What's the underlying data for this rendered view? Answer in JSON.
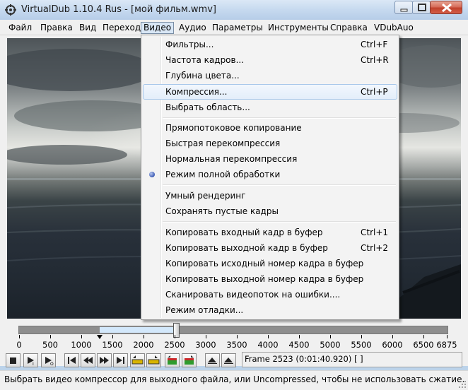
{
  "window": {
    "title": "VirtualDub 1.10.4 Rus - [мой фильм.wmv]"
  },
  "menubar": {
    "items": [
      "Файл",
      "Правка",
      "Вид",
      "Переход",
      "Видео",
      "Аудио",
      "Параметры",
      "Инструменты",
      "Справка",
      "VDubAuo"
    ],
    "open_item": "Видео"
  },
  "video_menu": {
    "items": [
      {
        "label": "Фильтры...",
        "shortcut": "Ctrl+F"
      },
      {
        "label": "Частота кадров...",
        "shortcut": "Ctrl+R"
      },
      {
        "label": "Глубина цвета...",
        "shortcut": ""
      },
      {
        "label": "Компрессия...",
        "shortcut": "Ctrl+P",
        "highlighted": true
      },
      {
        "label": "Выбрать область...",
        "shortcut": ""
      },
      {
        "label": "Прямопотоковое копирование",
        "shortcut": ""
      },
      {
        "label": "Быстрая перекомпрессия",
        "shortcut": ""
      },
      {
        "label": "Нормальная перекомпрессия",
        "shortcut": ""
      },
      {
        "label": "Режим полной обработки",
        "shortcut": "",
        "selected": true
      },
      {
        "label": "Умный рендеринг",
        "shortcut": ""
      },
      {
        "label": "Сохранять пустые кадры",
        "shortcut": ""
      },
      {
        "label": "Копировать входный кадр в буфер",
        "shortcut": "Ctrl+1"
      },
      {
        "label": "Копировать выходной кадр в буфер",
        "shortcut": "Ctrl+2"
      },
      {
        "label": "Копировать исходный номер кадра в буфер",
        "shortcut": ""
      },
      {
        "label": "Копировать выходной номер кадра в буфер",
        "shortcut": ""
      },
      {
        "label": "Сканировать видеопоток на ошибки....",
        "shortcut": ""
      },
      {
        "label": "Режим отладки...",
        "shortcut": ""
      }
    ]
  },
  "timeline": {
    "ticks": [
      "0",
      "500",
      "1000",
      "1500",
      "2000",
      "2500",
      "3000",
      "3500",
      "4000",
      "4500",
      "5000",
      "5500",
      "6000",
      "6500",
      "6875"
    ],
    "total_frames": 6875,
    "current_frame": 2523,
    "selection_start": 1300
  },
  "toolbar": {
    "buttons": [
      "stop-icon",
      "play-input-icon",
      "play-output-icon",
      "go-start-icon",
      "prev-frame-icon",
      "next-frame-icon",
      "go-end-icon",
      "prev-keyframe-icon",
      "next-keyframe-icon",
      "scene-back-icon",
      "scene-forward-icon",
      "mark-in-icon",
      "mark-out-icon"
    ],
    "frame_info": "Frame 2523 (0:01:40.920) [ ]"
  },
  "status": {
    "text": "Выбрать видео компрессор для выходного файла, или Uncompressed, чтобы не использовать сжатие."
  }
}
